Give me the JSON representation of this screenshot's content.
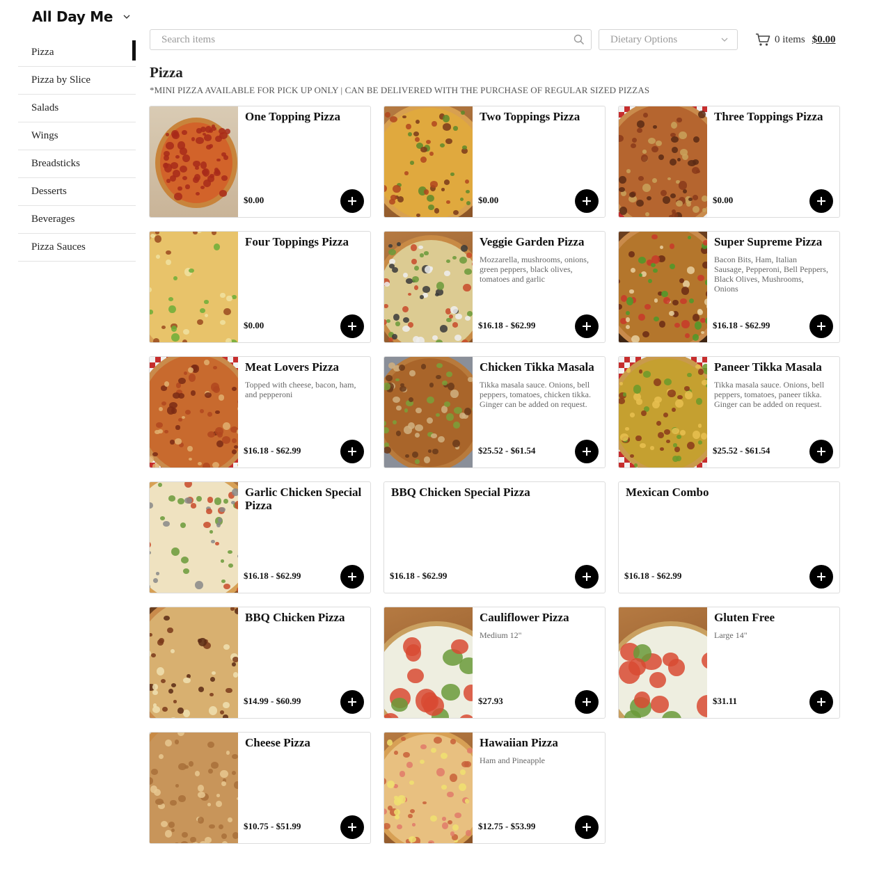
{
  "header": {
    "menu_name": "All Day Me",
    "search_placeholder": "Search items",
    "dietary_placeholder": "Dietary Options",
    "cart_items": "0 items",
    "cart_total": "$0.00"
  },
  "sidebar": {
    "items": [
      {
        "label": "Pizza",
        "active": true
      },
      {
        "label": "Pizza by Slice"
      },
      {
        "label": "Salads"
      },
      {
        "label": "Wings"
      },
      {
        "label": "Breadsticks"
      },
      {
        "label": "Desserts"
      },
      {
        "label": "Beverages"
      },
      {
        "label": "Pizza Sauces"
      }
    ]
  },
  "section": {
    "title": "Pizza",
    "note": "*MINI PIZZA AVAILABLE FOR PICK UP ONLY | CAN BE DELIVERED WITH THE PURCHASE OF REGULAR SIZED PIZZAS"
  },
  "items": [
    {
      "name": "One Topping Pizza",
      "desc": "",
      "price": "$0.00",
      "photo": "pepperoni-in-box"
    },
    {
      "name": "Two Toppings Pizza",
      "desc": "",
      "price": "$0.00",
      "photo": "jalapeno-pizza"
    },
    {
      "name": "Three Toppings Pizza",
      "desc": "",
      "price": "$0.00",
      "photo": "meat-pizza"
    },
    {
      "name": "Four Toppings Pizza",
      "desc": "",
      "price": "$0.00",
      "photo": "veggie-closeup"
    },
    {
      "name": "Veggie Garden Pizza",
      "desc": "Mozzarella, mushrooms, onions, green peppers, black olives, tomatoes and garlic",
      "price": "$16.18 - $62.99",
      "photo": "veggie-pizza"
    },
    {
      "name": "Super Supreme Pizza",
      "desc": "Bacon Bits, Ham, Italian Sausage, Pepperoni, Bell Peppers, Black Olives, Mushrooms, Onions",
      "price": "$16.18 - $62.99",
      "photo": "supreme-pizza"
    },
    {
      "name": "Meat Lovers Pizza",
      "desc": "Topped with cheese, bacon, ham, and pepperoni",
      "price": "$16.18 - $62.99",
      "photo": "meat-lovers"
    },
    {
      "name": "Chicken Tikka Masala",
      "desc": "Tikka masala sauce. Onions, bell peppers, tomatoes, chicken tikka. Ginger can be added on request.",
      "price": "$25.52 - $61.54",
      "photo": "chicken-tikka"
    },
    {
      "name": "Paneer Tikka Masala",
      "desc": "Tikka masala sauce. Onions, bell peppers, tomatoes, paneer tikka. Ginger can be added on request.",
      "price": "$25.52 - $61.54",
      "photo": "paneer-tikka"
    },
    {
      "name": "Garlic Chicken Special Pizza",
      "desc": "",
      "price": "$16.18 - $62.99",
      "photo": "garlic-chicken"
    },
    {
      "name": "BBQ Chicken Special Pizza",
      "desc": "",
      "price": "$16.18 - $62.99",
      "photo": ""
    },
    {
      "name": "Mexican Combo",
      "desc": "",
      "price": "$16.18 - $62.99",
      "photo": ""
    },
    {
      "name": "BBQ Chicken Pizza",
      "desc": "",
      "price": "$14.99 - $60.99",
      "photo": "bbq-chicken"
    },
    {
      "name": "Cauliflower Pizza",
      "desc": "Medium 12\"",
      "price": "$27.93",
      "photo": "pepperoni-slice"
    },
    {
      "name": "Gluten Free",
      "desc": "Large 14\"",
      "price": "$31.11",
      "photo": "pepperoni-slice"
    },
    {
      "name": "Cheese Pizza",
      "desc": "",
      "price": "$10.75 - $51.99",
      "photo": "cheese-pizza"
    },
    {
      "name": "Hawaiian Pizza",
      "desc": "Ham and Pineapple",
      "price": "$12.75 - $53.99",
      "photo": "hawaiian-pizza"
    }
  ],
  "icons": {
    "search": "search-icon",
    "chevron": "chevron-down-icon",
    "cart": "cart-icon",
    "add": "plus-icon"
  }
}
